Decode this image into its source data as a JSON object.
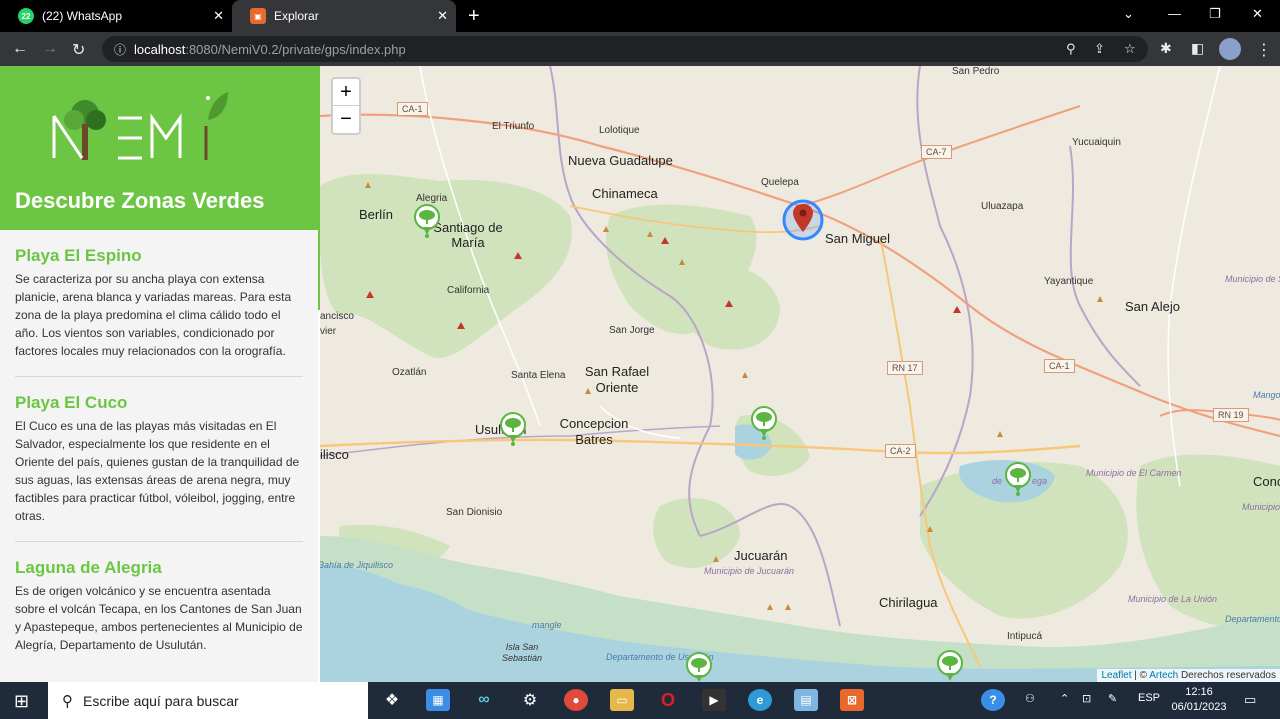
{
  "browser": {
    "tabs": [
      {
        "title": "(22) WhatsApp",
        "favicon_text": "22",
        "favicon_color": "#25d366"
      },
      {
        "title": "Explorar",
        "favicon_text": "",
        "favicon_color": "#e8692c"
      }
    ],
    "url_host": "localhost",
    "url_path": ":8080/NemiV0.2/private/gps/index.php"
  },
  "sidebar": {
    "logo_text": "NEMI",
    "heading": "Descubre Zonas Verdes",
    "places": [
      {
        "title": "Playa El Espino",
        "description": "Se caracteriza por su ancha playa con extensa planicie, arena blanca y variadas mareas. Para esta zona de la playa predomina el clima cálido todo el año. Los vientos son variables, condicionado por factores locales muy relacionados con la orografía."
      },
      {
        "title": "Playa El Cuco",
        "description": "El Cuco es una de las playas más visitadas en El Salvador, especialmente los que residente en el Oriente del país, quienes gustan de la tranquilidad de sus aguas, las extensas áreas de arena negra, muy factibles para practicar fútbol, vóleibol, jogging, entre otras."
      },
      {
        "title": "Laguna de Alegria",
        "description": "Es de origen volcánico y se encuentra asentada sobre el volcán Tecapa, en los Cantones de San Juan y Apastepeque, ambos pertenecientes al Municipio de Alegría, Departamento de Usulután."
      }
    ]
  },
  "map": {
    "zoom_in": "+",
    "zoom_out": "−",
    "labels": {
      "san_pedro": "San Pedro",
      "el_triunfo": "El Triunfo",
      "lolotique": "Lolotique",
      "nueva_guadalupe": "Nueva Guadalupe",
      "chinameca": "Chinameca",
      "quelepa": "Quelepa",
      "san_miguel": "San Miguel",
      "uluazapa": "Uluazapa",
      "yucuaiquin": "Yucuaiquin",
      "alegria": "Alegria",
      "berlin": "Berlín",
      "santiago_de_maria": "Santiago de María",
      "california": "California",
      "yayantique": "Yayantique",
      "san_alejo": "San Alejo",
      "municipio_san_alejo": "Municipio de San Alejo",
      "francisco": "ancisco",
      "vier": "vier",
      "san_jorge": "San Jorge",
      "ozatlan": "Ozatlán",
      "santa_elena": "Santa Elena",
      "san_rafael_oriente": "San Rafael Oriente",
      "usulutan": "Usulután",
      "concepcion_batres": "Concepcion Batres",
      "lisco": "ilisco",
      "municipio_el_carmen": "Municipio de El Carmen",
      "el_sauce_fragment": "de",
      "ega_fragment": "ega",
      "san_dionisio": "San Dionisio",
      "jucuaran": "Jucuarán",
      "municipio_jucuaran": "Municipio de Jucuarán",
      "chirilagua": "Chirilagua",
      "municipio_la_union": "Municipio de La Unión",
      "intipuca": "Intipucá",
      "bahia_jiquilisco": "Bahía de Jiquilisco",
      "mangle": "mangle",
      "isla_san_sebastian": "Isla San Sebastián",
      "departamento_usulutan": "Departamento de Usulután",
      "departamento_right": "Departamento",
      "conc_right": "Conc",
      "mango_right": "Mango",
      "municipio_conc": "Municipio de Conc"
    },
    "shields": {
      "ca1_top": "CA-1",
      "ca7": "CA-7",
      "rn17": "RN 17",
      "ca1_right": "CA-1",
      "rn19": "RN 19",
      "ca2": "CA-2"
    },
    "attribution": {
      "leaflet": "Leaflet",
      "sep": " | © ",
      "artech": "Artech",
      "rights": " Derechos reservados"
    }
  },
  "taskbar": {
    "search_placeholder": "Escribe aquí para buscar",
    "language": "ESP",
    "time": "12:16",
    "date": "06/01/2023"
  }
}
